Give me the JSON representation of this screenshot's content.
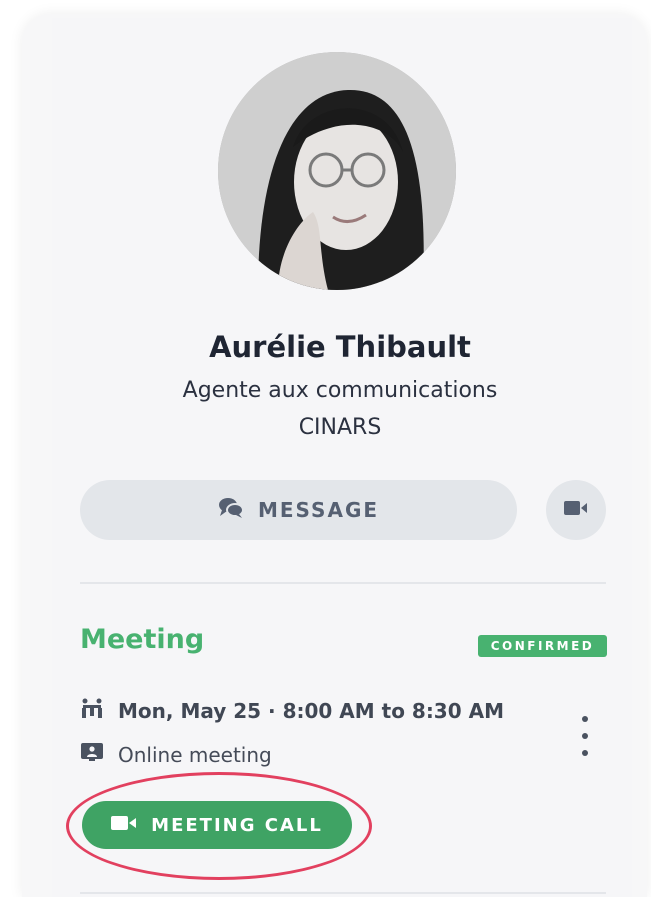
{
  "profile": {
    "name": "Aurélie Thibault",
    "title": "Agente aux communications",
    "company": "CINARS"
  },
  "actions": {
    "message_label": "MESSAGE",
    "message_icon": "chat-bubbles-icon",
    "video_icon": "video-camera-icon"
  },
  "meeting": {
    "heading": "Meeting",
    "status": "CONFIRMED",
    "datetime": "Mon, May 25 · 8:00 AM to 8:30 AM",
    "datetime_icon": "meeting-table-icon",
    "location": "Online meeting",
    "location_icon": "screen-presenter-icon",
    "call_label": "MEETING CALL",
    "call_icon": "video-camera-icon"
  },
  "colors": {
    "accent_green": "#48b270",
    "button_green": "#3fa364",
    "annotation_red": "#e2405f",
    "button_gray": "#e3e6ea"
  }
}
